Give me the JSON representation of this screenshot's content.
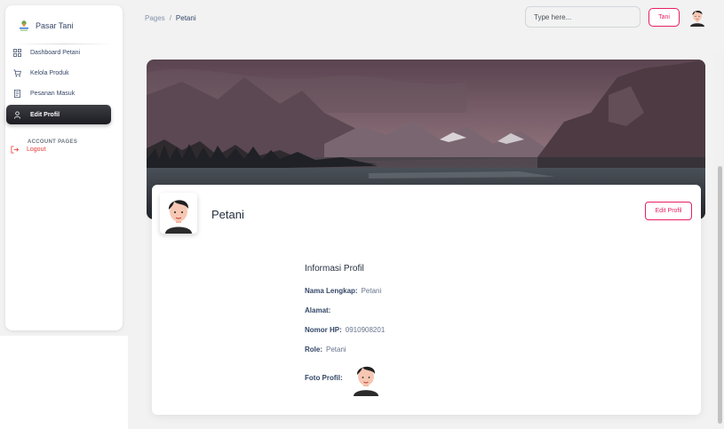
{
  "sidebar": {
    "brand": "Pasar Tani",
    "items": [
      {
        "label": "Dashboard Petani",
        "icon": "dashboard-icon"
      },
      {
        "label": "Kelola Produk",
        "icon": "cart-icon"
      },
      {
        "label": "Pesanan Masuk",
        "icon": "receipt-icon"
      },
      {
        "label": "Edit Profil",
        "icon": "user-icon",
        "active": true
      }
    ],
    "section_title": "ACCOUNT PAGES",
    "logout": "Logout"
  },
  "header": {
    "breadcrumb": [
      "Pages",
      "/",
      "Petani"
    ],
    "search_placeholder": "Type here...",
    "role_button": "Tani"
  },
  "profile": {
    "name": "Petani",
    "edit_button": "Edit Profil",
    "info_title": "Informasi Profil",
    "fields": [
      {
        "label": "Nama Lengkap:",
        "value": "Petani"
      },
      {
        "label": "Alamat:",
        "value": ""
      },
      {
        "label": "Nomor HP:",
        "value": "0910908201"
      },
      {
        "label": "Role:",
        "value": "Petani"
      }
    ],
    "photo_label": "Foto Profil:"
  },
  "colors": {
    "accent": "#e91e63",
    "logout": "#e53935",
    "active_nav": "#2a2a30"
  }
}
